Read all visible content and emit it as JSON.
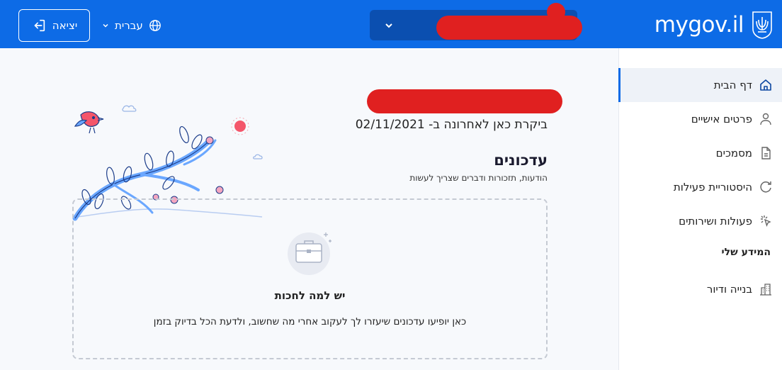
{
  "header": {
    "logout_label": "יציאה",
    "language_label": "עברית",
    "logo_text": "mygov.il",
    "user_name": "",
    "bg_color": "#0d6be6"
  },
  "sidebar": {
    "items": [
      {
        "label": "דף הבית",
        "icon": "home-icon",
        "active": true
      },
      {
        "label": "פרטים אישיים",
        "icon": "person-icon"
      },
      {
        "label": "מסמכים",
        "icon": "document-icon"
      },
      {
        "label": "היסטוריית פעילות",
        "icon": "history-icon"
      },
      {
        "label": "פעולות ושירותים",
        "icon": "click-icon"
      }
    ],
    "section_heading": "המידע שלי",
    "section_items": [
      {
        "label": "בנייה ודיור",
        "icon": "building-icon"
      }
    ]
  },
  "main": {
    "last_visit": "ביקרת כאן לאחרונה ב- 02/11/2021",
    "updates_title": "עדכונים",
    "updates_subtitle": "הודעות, תזכורות ודברים שצריך לעשות",
    "empty_title": "יש למה לחכות",
    "empty_description": "כאן יופיעו עדכונים שיעזרו לך לעקוב אחרי מה שחשוב, ולדעת הכל בדיוק בזמן"
  }
}
